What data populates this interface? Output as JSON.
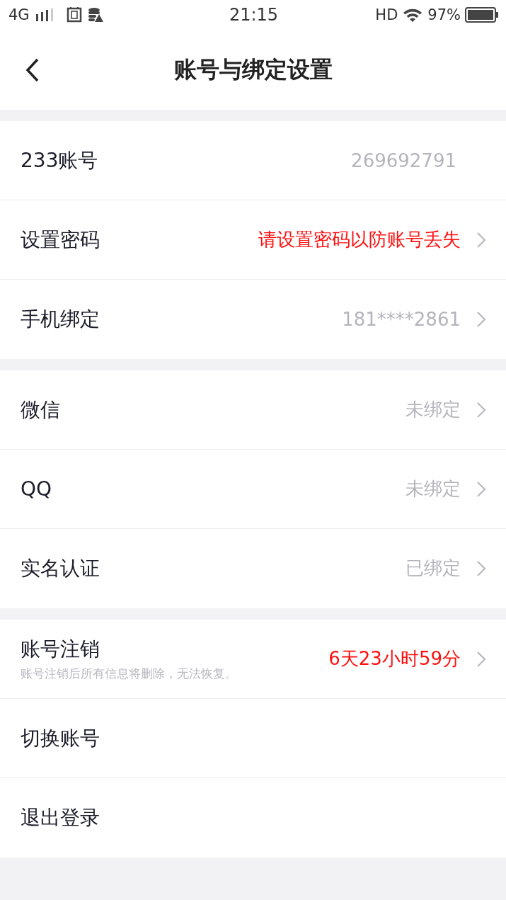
{
  "status_bar": {
    "network": "4G",
    "time": "21:15",
    "hd": "HD",
    "battery": "97%"
  },
  "header": {
    "title": "账号与绑定设置"
  },
  "groups": [
    [
      {
        "label": "233账号",
        "value": "269692791",
        "chevron": false
      },
      {
        "label": "设置密码",
        "value": "请设置密码以防账号丢失",
        "alert": true,
        "chevron": true
      },
      {
        "label": "手机绑定",
        "value": "181****2861",
        "chevron": true
      }
    ],
    [
      {
        "label": "微信",
        "value": "未绑定",
        "chevron": true
      },
      {
        "label": "QQ",
        "value": "未绑定",
        "chevron": true
      },
      {
        "label": "实名认证",
        "value": "已绑定",
        "chevron": true
      }
    ],
    [
      {
        "label": "账号注销",
        "sub": "账号注销后所有信息将删除，无法恢复。",
        "value": "6天23小时59分",
        "alert": true,
        "chevron": true
      },
      {
        "label": "切换账号",
        "chevron": false
      },
      {
        "label": "退出登录",
        "chevron": false
      }
    ]
  ]
}
